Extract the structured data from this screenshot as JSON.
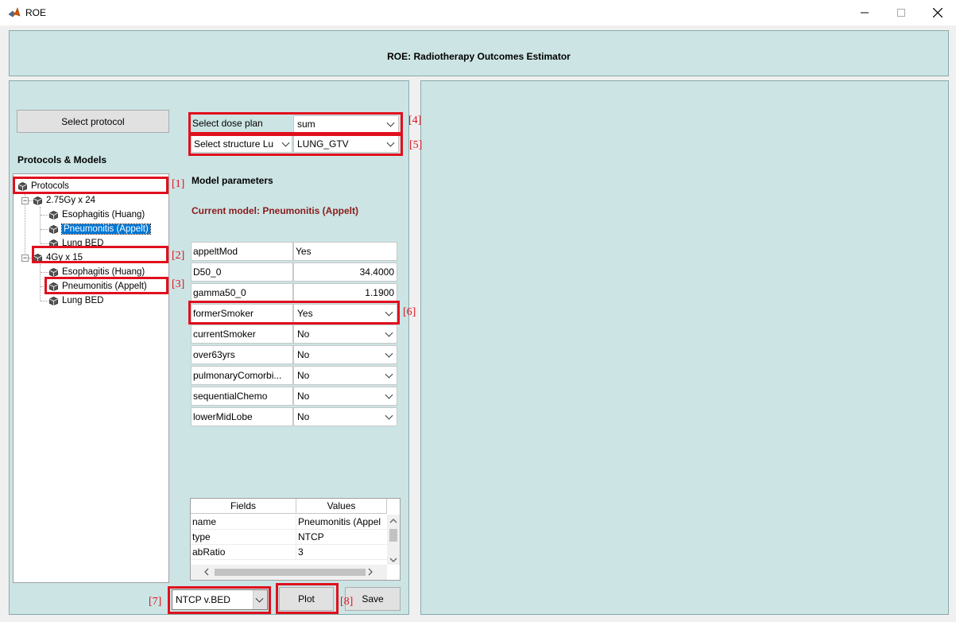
{
  "window": {
    "title": "ROE"
  },
  "header": {
    "title": "ROE: Radiotherapy Outcomes Estimator"
  },
  "left": {
    "select_protocol_label": "Select protocol",
    "protocols_models_label": "Protocols & Models",
    "tree": {
      "root": "Protocols",
      "protocol_1": {
        "label": "2.75Gy x 24",
        "models": [
          "Esophagitis (Huang)",
          "Pneumonitis (Appelt)",
          "Lung BED"
        ]
      },
      "protocol_2": {
        "label": "4Gy x 15",
        "models": [
          "Esophagitis (Huang)",
          "Pneumonitis (Appelt)",
          "Lung BED"
        ]
      }
    },
    "plot_type": {
      "value": "NTCP v.BED"
    },
    "plot_label": "Plot",
    "save_label": "Save"
  },
  "middle": {
    "dose_plan": {
      "label": "Select dose plan",
      "value": "sum"
    },
    "structure": {
      "label": "Select structure Lu",
      "value": "LUNG_GTV"
    },
    "model_parameters_label": "Model parameters",
    "current_model_label": "Current model:  Pneumonitis (Appelt)",
    "params": [
      {
        "name": "appeltMod",
        "value": "Yes"
      },
      {
        "name": "D50_0",
        "value": "34.4000"
      },
      {
        "name": "gamma50_0",
        "value": "1.1900"
      },
      {
        "name": "formerSmoker",
        "value": "Yes"
      },
      {
        "name": "currentSmoker",
        "value": "No"
      },
      {
        "name": "over63yrs",
        "value": "No"
      },
      {
        "name": "pulmonaryComorbi...",
        "value": "No"
      },
      {
        "name": "sequentialChemo",
        "value": "No"
      },
      {
        "name": "lowerMidLobe",
        "value": "No"
      }
    ],
    "table": {
      "headers": [
        "Fields",
        "Values"
      ],
      "rows": [
        {
          "field": "name",
          "value": "Pneumonitis (Appel"
        },
        {
          "field": "type",
          "value": "NTCP"
        },
        {
          "field": "abRatio",
          "value": "3"
        }
      ]
    }
  },
  "annotations": [
    "[1]",
    "[2]",
    "[3]",
    "[4]",
    "[5]",
    "[6]",
    "[7]",
    "[8]"
  ],
  "colors": {
    "panel": "#cce4e4",
    "annotation_red": "#e0101e",
    "current_model": "#8b1a1a",
    "selection": "#0078d7"
  }
}
